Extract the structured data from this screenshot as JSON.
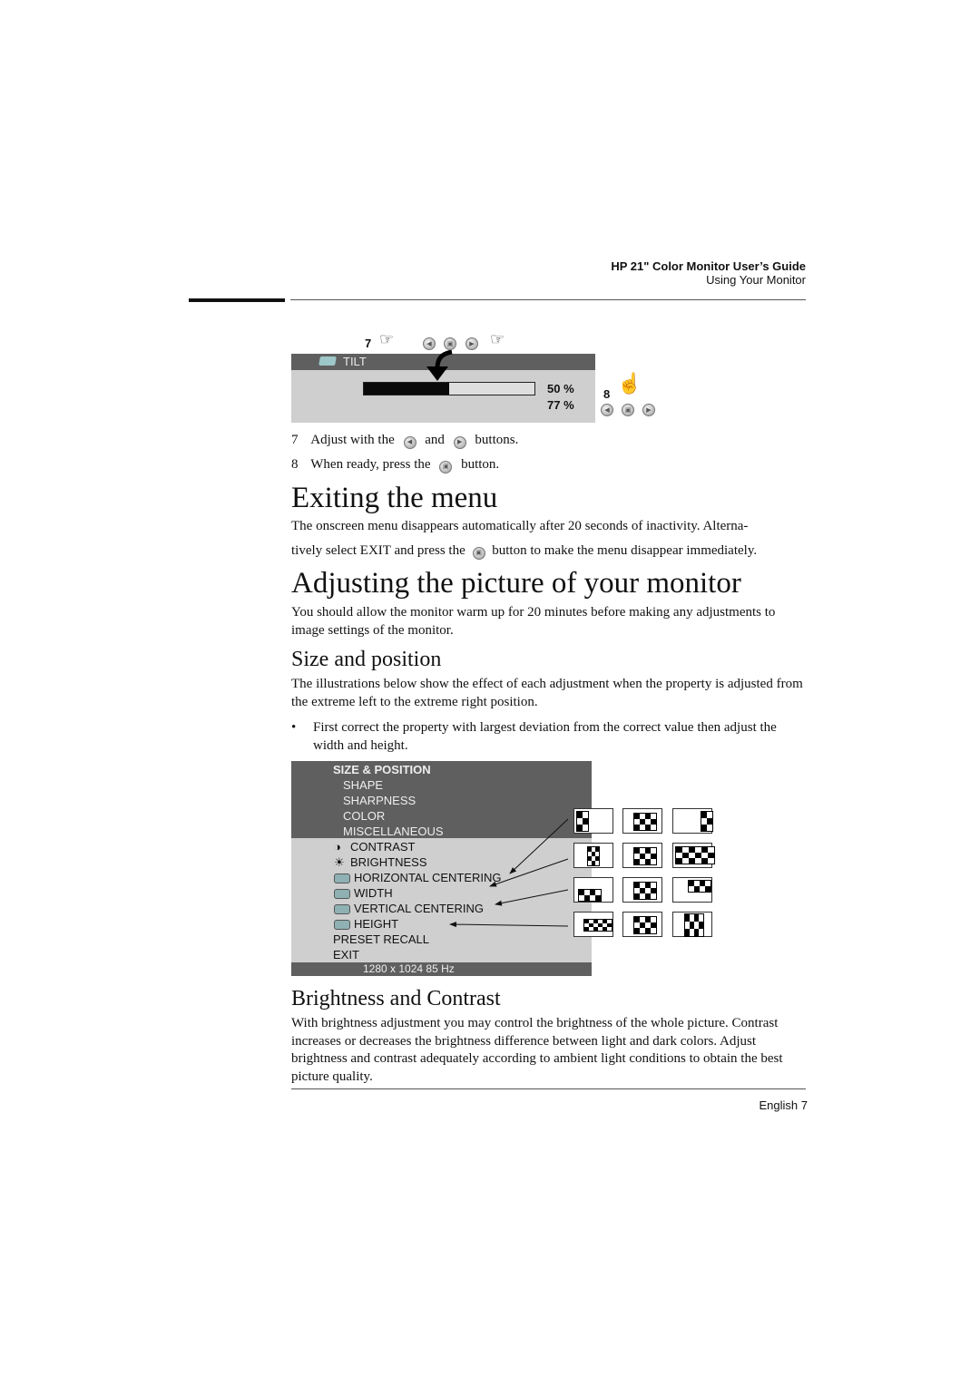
{
  "header": {
    "title": "HP 21\" Color Monitor User’s Guide",
    "subtitle": "Using Your Monitor"
  },
  "tilt_osd": {
    "step7_label": "7",
    "step8_label": "8",
    "menu_title": "TILT",
    "progress_percent": 50,
    "value_primary": "50 %",
    "value_secondary": "77 %",
    "icons": [
      "pointing-hand-icon",
      "left-button-icon",
      "menu-button-icon",
      "right-button-icon",
      "pointing-hand-icon",
      "pressing-hand-icon"
    ]
  },
  "steps": [
    {
      "num": "7",
      "before": "Adjust with the",
      "mid": "and",
      "after": "buttons."
    },
    {
      "num": "8",
      "before": "When ready, press the",
      "after": "button."
    }
  ],
  "exiting": {
    "heading": "Exiting the menu",
    "line1": "The onscreen menu disappears automatically after 20 seconds of inactivity. Alterna-",
    "line2_before": "tively select EXIT and press the",
    "line2_after": "button to make the menu disappear immediately."
  },
  "adjusting": {
    "heading": "Adjusting the picture of your monitor",
    "para": "You should allow the monitor warm up for 20 minutes before making any adjustments to image settings of the monitor."
  },
  "size_position": {
    "heading": "Size and position",
    "para": "The illustrations below show the effect of each adjustment when the property is adjusted from the extreme left to the extreme right position.",
    "bullet": "First correct the property with largest deviation from the correct value then adjust the width and height.",
    "bullet_mark": "•"
  },
  "sp_osd": {
    "title": "SIZE & POSITION",
    "top_items": [
      "SHAPE",
      "SHARPNESS",
      "COLOR",
      "MISCELLANEOUS"
    ],
    "items": [
      {
        "label": "CONTRAST",
        "icon": "contrast-icon"
      },
      {
        "label": "BRIGHTNESS",
        "icon": "brightness-icon"
      },
      {
        "label": "HORIZONTAL CENTERING",
        "icon": "horizontal-centering-icon"
      },
      {
        "label": "WIDTH",
        "icon": "width-icon"
      },
      {
        "label": "VERTICAL CENTERING",
        "icon": "vertical-centering-icon"
      },
      {
        "label": "HEIGHT",
        "icon": "height-icon"
      }
    ],
    "plain_items": [
      "PRESET RECALL",
      "EXIT"
    ],
    "status": "1280 x 1024  85 Hz"
  },
  "brightness_contrast": {
    "heading": "Brightness and Contrast",
    "para": "With brightness adjustment you may control the brightness of the whole picture. Contrast increases or decreases the brightness difference between light and dark colors. Adjust brightness and contrast adequately according to ambient light conditions to obtain the best picture quality."
  },
  "footer": {
    "page": "English 7"
  }
}
